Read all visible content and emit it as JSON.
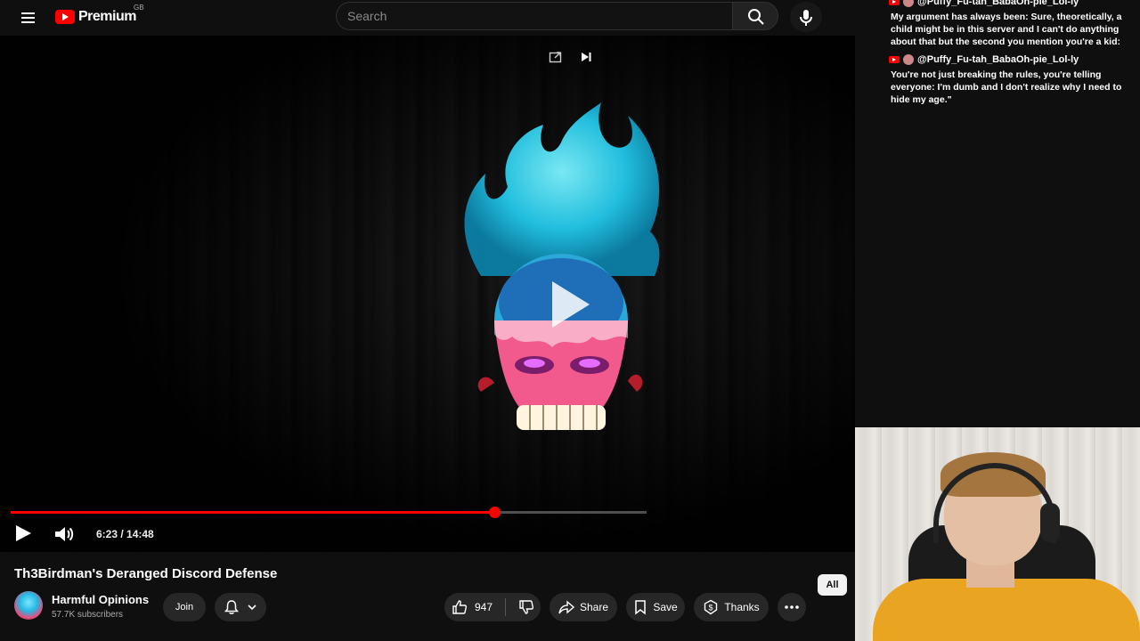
{
  "header": {
    "logo_text": "Premium",
    "region": "GB",
    "search_placeholder": "Search"
  },
  "player": {
    "time_display": "6:23 / 14:48",
    "progress_fraction": 0.7602,
    "buffered_fraction": 1.0
  },
  "video": {
    "title": "Th3Birdman's Deranged Discord Defense"
  },
  "channel": {
    "name": "Harmful Opinions",
    "subscribers": "57.7K subscribers",
    "join_label": "Join"
  },
  "actions": {
    "like_count": "947",
    "share_label": "Share",
    "save_label": "Save",
    "thanks_label": "Thanks"
  },
  "chips": {
    "all_label": "All"
  },
  "chat_overlay": [
    {
      "author": "@Puffy_Fu-tah_BabaOh-pie_Lol-ly",
      "text": "My argument has always been: Sure, theoretically, a child might be in this server and I can't do anything about that but the second you mention you're a kid:"
    },
    {
      "author": "@Puffy_Fu-tah_BabaOh-pie_Lol-ly",
      "text": "You're not just breaking the rules, you're telling everyone: I'm dumb and I don't realize why I need to hide my age.\""
    }
  ],
  "colors": {
    "accent": "#ff0000",
    "background": "#0f0f0f",
    "pill": "#272727",
    "shirt": "#e9a521"
  }
}
